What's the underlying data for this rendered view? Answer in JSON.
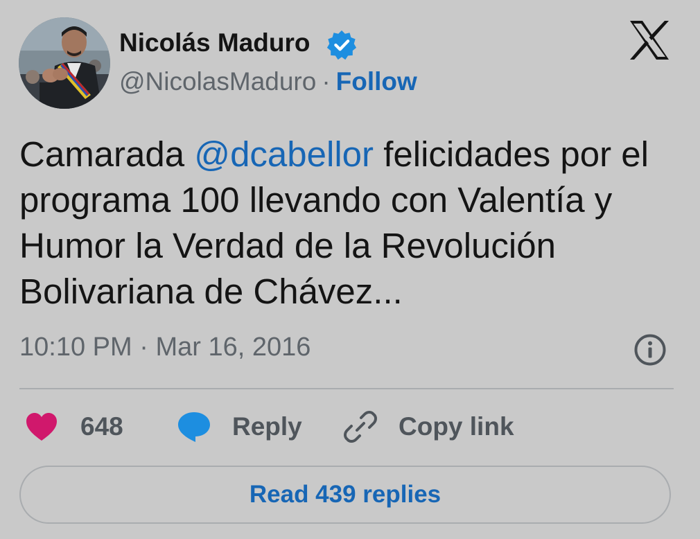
{
  "author": {
    "name": "Nicolás Maduro",
    "handle": "@NicolasMaduro",
    "separator": "·",
    "follow_label": "Follow",
    "verified": true,
    "avatar_icon": "avatar-photo"
  },
  "tweet": {
    "text_parts": [
      {
        "type": "text",
        "value": "Camarada "
      },
      {
        "type": "mention",
        "value": "@dcabellor"
      },
      {
        "type": "text",
        "value": " felicidades por el programa 100 llevando con Valentía y Humor la Verdad de la Revolución Bolivariana de Chávez..."
      }
    ],
    "time": "10:10 PM",
    "date_separator": "·",
    "date": "Mar 16, 2016"
  },
  "actions": {
    "like_count": "648",
    "reply_label": "Reply",
    "copy_link_label": "Copy link"
  },
  "footer": {
    "read_replies_label": "Read 439 replies"
  },
  "icons": {
    "brand": "x-logo-icon",
    "verified": "verified-badge-icon",
    "info": "info-icon",
    "like": "heart-icon",
    "reply": "speech-bubble-icon",
    "copy": "link-icon"
  },
  "colors": {
    "background": "#c9c9c9",
    "link": "#1766b5",
    "heart": "#d0186c",
    "reply_bubble": "#1d8ee0",
    "verified": "#1d8ee0",
    "muted_text": "#5f656b"
  }
}
